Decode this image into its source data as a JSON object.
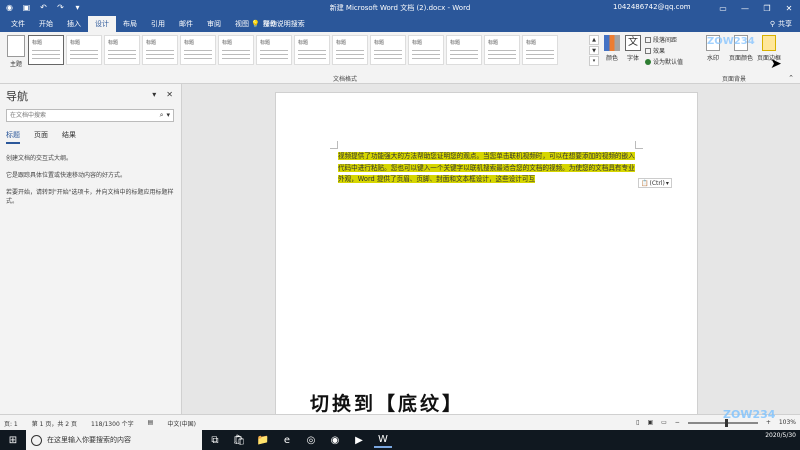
{
  "titlebar": {
    "doc_title": "新建 Microsoft Word 文档 (2).docx - Word",
    "user": "1042486742@qq.com"
  },
  "tabs": [
    "文件",
    "开始",
    "插入",
    "设计",
    "布局",
    "引用",
    "邮件",
    "审阅",
    "视图",
    "帮助"
  ],
  "tell_me": "操作说明搜索",
  "share": "共享",
  "ribbon": {
    "theme_label": "主题",
    "style_titles": [
      "标题",
      "标题",
      "标题",
      "标题",
      "标题",
      "标题",
      "标题",
      "标题",
      "标题",
      "标题",
      "标题",
      "标题",
      "标题",
      "标题"
    ],
    "colors_label": "颜色",
    "fonts_label": "字体",
    "paragraph_spacing": "段落间距",
    "effects": "效果",
    "set_default": "设为默认值",
    "watermark": "水印",
    "page_color": "页面颜色",
    "page_borders": "页面边框",
    "group_docfmt": "文档格式",
    "group_pagebg": "页面背景"
  },
  "nav": {
    "title": "导航",
    "search_placeholder": "在文档中搜索",
    "tabs": [
      "标题",
      "页面",
      "结果"
    ],
    "body": [
      "创建文档的交互式大纲。",
      "它是跟踪具体位置或快速移动内容的好方式。",
      "若要开始，请转到\"开始\"选项卡，并向文档中的标题应用标题样式。"
    ]
  },
  "document": {
    "text": "视频提供了功能强大的方法帮助您证明您的观点。当您单击联机视频时，可以在想要添加的视频的嵌入代码中进行粘贴。您也可以键入一个关键字以联机搜索最适合您的文档的视频。为使您的文档具有专业外观，Word 提供了页眉、页脚、封面和文本框设计，这些设计可互",
    "paste_option": "(Ctrl)"
  },
  "subtitle": "切换到【底纹】",
  "status": {
    "page": "页: 1",
    "pages": "第 1 页，共 2 页",
    "words": "118/1300 个字",
    "lang": "中文(中国)",
    "zoom": "103%"
  },
  "taskbar": {
    "search": "在这里输入你要搜索的内容",
    "date": "2020/5/30"
  },
  "watermark_text": "ZOW234"
}
